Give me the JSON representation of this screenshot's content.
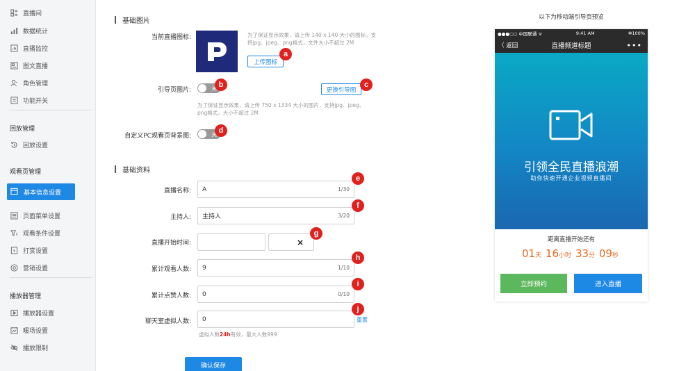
{
  "sidebar": {
    "items": [
      {
        "label": "直播间",
        "icon": "grid-icon"
      },
      {
        "label": "数据统计",
        "icon": "bar-chart-icon"
      },
      {
        "label": "直播监控",
        "icon": "monitor-chart-icon"
      },
      {
        "label": "图文直播",
        "icon": "image-text-icon"
      },
      {
        "label": "角色管理",
        "icon": "user-icon"
      },
      {
        "label": "功能开关",
        "icon": "toggle-box-icon"
      }
    ],
    "replay_group": "回放管理",
    "replay_items": [
      {
        "label": "回放设置",
        "icon": "replay-icon"
      }
    ],
    "watch_group": "观看页管理",
    "watch_items": [
      {
        "label": "基本信息设置",
        "icon": "window-icon",
        "active": true
      },
      {
        "label": "页面菜单设置",
        "icon": "menu-icon"
      },
      {
        "label": "观看条件设置",
        "icon": "filter-icon"
      },
      {
        "label": "打赏设置",
        "icon": "reward-icon"
      },
      {
        "label": "营销设置",
        "icon": "marketing-icon"
      }
    ],
    "player_group": "播放器管理",
    "player_items": [
      {
        "label": "播放器设置",
        "icon": "play-icon"
      },
      {
        "label": "暖场设置",
        "icon": "warmup-icon"
      },
      {
        "label": "播放限制",
        "icon": "restrict-icon"
      }
    ]
  },
  "basic_images": {
    "section_title": "基础图片",
    "current_icon_label": "当前直播图标:",
    "icon_hint": "为了保证显示效果，请上传 140 x 140 大小的图标，支持jpg、jpeg、png格式，文件大小不超过 2M",
    "upload_button": "上传图标",
    "guide_page_label": "引导页图片:",
    "guide_toggle": "关",
    "change_guide_button": "更换引导图",
    "guide_hint": "为了保证显示效果，请上传 750 x 1334 大小的图片，支持jpg、jpeg、png格式，大小不超过 2M",
    "pc_bg_label": "自定义PC观看页背景图:",
    "pc_bg_toggle": "关"
  },
  "basic_info": {
    "section_title": "基础资料",
    "live_name_label": "直播名称:",
    "live_name_value": "A",
    "live_name_count": "1/30",
    "host_label": "主持人:",
    "host_value": "主持人",
    "host_count": "3/20",
    "start_time_label": "直播开始时间:",
    "start_time_clear": "×",
    "viewers_label": "累计观看人数:",
    "viewers_value": "9",
    "viewers_count": "1/10",
    "likes_label": "累计点赞人数:",
    "likes_value": "0",
    "likes_count": "0/10",
    "virtual_label": "聊天室虚拟人数:",
    "virtual_value": "0",
    "virtual_reset": "重置",
    "virtual_hint_pre": "虚拟人数",
    "virtual_hint_strong": "24h",
    "virtual_hint_post": "有效，最大人数999",
    "save_button": "确认保存"
  },
  "badges": [
    "a",
    "b",
    "c",
    "d",
    "e",
    "f",
    "g",
    "h",
    "i",
    "j"
  ],
  "preview": {
    "title": "以下为移动端引导页预览",
    "status_left": "●●●○○ 中国联通 ᯤ",
    "status_time": "9:41 AM",
    "status_right": "✻100%",
    "nav_back": "〈 返回",
    "nav_title": "直播频道标题",
    "nav_more": "•••",
    "headline": "引领全民直播浪潮",
    "subline": "助你快速开通企业视频直播间",
    "countdown_label": "距离直播开始还有",
    "countdown": {
      "days": "01",
      "days_unit": "天",
      "hours": "16",
      "hours_unit": "小时",
      "minutes": "33",
      "minutes_unit": "分",
      "seconds": "09",
      "seconds_unit": "秒"
    },
    "reserve_button": "立即预约",
    "enter_button": "进入直播"
  },
  "colors": {
    "primary": "#1e88e5",
    "badge": "#e0211d",
    "countdown": "#e56b1f",
    "green": "#5cb85c",
    "logo_bg": "#1f2a7a"
  }
}
